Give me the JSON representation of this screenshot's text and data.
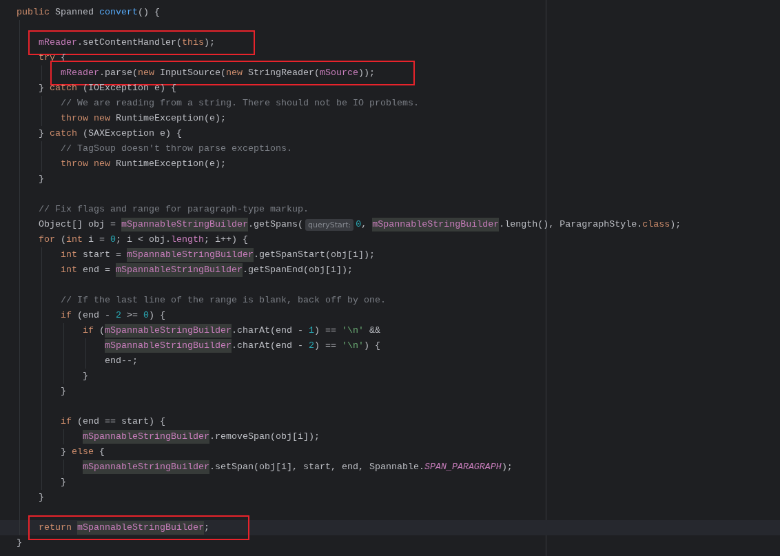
{
  "editor": {
    "lines": [
      {
        "boxed": false,
        "current": false,
        "tokens": [
          {
            "kind": "kw",
            "text": "public "
          },
          {
            "kind": "plain",
            "text": "Spanned "
          },
          {
            "kind": "decl",
            "text": "convert"
          },
          {
            "kind": "plain",
            "text": "() {"
          }
        ]
      },
      {
        "boxed": false,
        "current": false
      },
      {
        "boxed": true,
        "current": false,
        "tokens": [
          {
            "kind": "field",
            "text": "    mReader"
          },
          {
            "kind": "plain",
            "text": ".setContentHandler("
          },
          {
            "kind": "kw",
            "text": "this"
          },
          {
            "kind": "plain",
            "text": ");"
          }
        ]
      },
      {
        "boxed": false,
        "current": false,
        "tokens": [
          {
            "kind": "kw",
            "text": "    try "
          },
          {
            "kind": "plain",
            "text": "{"
          }
        ]
      },
      {
        "boxed": true,
        "current": false,
        "tokens": [
          {
            "kind": "field",
            "text": "        mReader"
          },
          {
            "kind": "plain",
            "text": ".parse("
          },
          {
            "kind": "kw",
            "text": "new "
          },
          {
            "kind": "plain",
            "text": "InputSource("
          },
          {
            "kind": "kw",
            "text": "new "
          },
          {
            "kind": "plain",
            "text": "StringReader("
          },
          {
            "kind": "field",
            "text": "mSource"
          },
          {
            "kind": "plain",
            "text": "));"
          }
        ]
      },
      {
        "boxed": false,
        "current": false,
        "tokens": [
          {
            "kind": "plain",
            "text": "    } "
          },
          {
            "kind": "kw",
            "text": "catch "
          },
          {
            "kind": "plain",
            "text": "(IOException e) {"
          }
        ]
      },
      {
        "boxed": false,
        "current": false,
        "tokens": [
          {
            "kind": "comment",
            "text": "        // We are reading from a string. There should not be IO problems."
          }
        ]
      },
      {
        "boxed": false,
        "current": false,
        "tokens": [
          {
            "kind": "kw",
            "text": "        throw new "
          },
          {
            "kind": "plain",
            "text": "RuntimeException(e);"
          }
        ]
      },
      {
        "boxed": false,
        "current": false,
        "tokens": [
          {
            "kind": "plain",
            "text": "    } "
          },
          {
            "kind": "kw",
            "text": "catch "
          },
          {
            "kind": "plain",
            "text": "(SAXException e) {"
          }
        ]
      },
      {
        "boxed": false,
        "current": false,
        "tokens": [
          {
            "kind": "comment",
            "text": "        // TagSoup doesn't throw parse exceptions."
          }
        ]
      },
      {
        "boxed": false,
        "current": false,
        "tokens": [
          {
            "kind": "kw",
            "text": "        throw new "
          },
          {
            "kind": "plain",
            "text": "RuntimeException(e);"
          }
        ]
      },
      {
        "boxed": false,
        "current": false,
        "tokens": [
          {
            "kind": "plain",
            "text": "    }"
          }
        ]
      },
      {
        "boxed": false,
        "current": false
      },
      {
        "boxed": false,
        "current": false,
        "tokens": [
          {
            "kind": "comment",
            "text": "    // Fix flags and range for paragraph-type markup."
          }
        ]
      },
      {
        "boxed": false,
        "current": false,
        "tokens": [
          {
            "kind": "plain",
            "text": "    Object[] obj = "
          },
          {
            "kind": "field-hl",
            "text": "mSpannableStringBuilder"
          },
          {
            "kind": "plain",
            "text": ".getSpans("
          },
          {
            "kind": "hint",
            "text": "queryStart:"
          },
          {
            "kind": "num",
            "text": "0"
          },
          {
            "kind": "plain",
            "text": ", "
          },
          {
            "kind": "field-hl",
            "text": "mSpannableStringBuilder"
          },
          {
            "kind": "plain",
            "text": ".length(), ParagraphStyle."
          },
          {
            "kind": "kw",
            "text": "class"
          },
          {
            "kind": "plain",
            "text": ");"
          }
        ]
      },
      {
        "boxed": false,
        "current": false,
        "tokens": [
          {
            "kind": "kw",
            "text": "    for "
          },
          {
            "kind": "plain",
            "text": "("
          },
          {
            "kind": "kw",
            "text": "int "
          },
          {
            "kind": "plain",
            "text": "i = "
          },
          {
            "kind": "num",
            "text": "0"
          },
          {
            "kind": "plain",
            "text": "; i < obj."
          },
          {
            "kind": "field",
            "text": "length"
          },
          {
            "kind": "plain",
            "text": "; i++) {"
          }
        ]
      },
      {
        "boxed": false,
        "current": false,
        "tokens": [
          {
            "kind": "kw",
            "text": "        int "
          },
          {
            "kind": "plain",
            "text": "start = "
          },
          {
            "kind": "field-hl",
            "text": "mSpannableStringBuilder"
          },
          {
            "kind": "plain",
            "text": ".getSpanStart(obj[i]);"
          }
        ]
      },
      {
        "boxed": false,
        "current": false,
        "tokens": [
          {
            "kind": "kw",
            "text": "        int "
          },
          {
            "kind": "plain",
            "text": "end = "
          },
          {
            "kind": "field-hl",
            "text": "mSpannableStringBuilder"
          },
          {
            "kind": "plain",
            "text": ".getSpanEnd(obj[i]);"
          }
        ]
      },
      {
        "boxed": false,
        "current": false
      },
      {
        "boxed": false,
        "current": false,
        "tokens": [
          {
            "kind": "comment",
            "text": "        // If the last line of the range is blank, back off by one."
          }
        ]
      },
      {
        "boxed": false,
        "current": false,
        "tokens": [
          {
            "kind": "kw",
            "text": "        if "
          },
          {
            "kind": "plain",
            "text": "(end - "
          },
          {
            "kind": "num",
            "text": "2"
          },
          {
            "kind": "plain",
            "text": " >= "
          },
          {
            "kind": "num",
            "text": "0"
          },
          {
            "kind": "plain",
            "text": ") {"
          }
        ]
      },
      {
        "boxed": false,
        "current": false,
        "tokens": [
          {
            "kind": "kw",
            "text": "            if "
          },
          {
            "kind": "plain",
            "text": "("
          },
          {
            "kind": "field-hl",
            "text": "mSpannableStringBuilder"
          },
          {
            "kind": "plain",
            "text": ".charAt(end - "
          },
          {
            "kind": "num",
            "text": "1"
          },
          {
            "kind": "plain",
            "text": ") == "
          },
          {
            "kind": "str",
            "text": "'\\n'"
          },
          {
            "kind": "plain",
            "text": " &&"
          }
        ]
      },
      {
        "boxed": false,
        "current": false,
        "tokens": [
          {
            "kind": "field-hl",
            "text": "                mSpannableStringBuilder"
          },
          {
            "kind": "plain",
            "text": ".charAt(end - "
          },
          {
            "kind": "num",
            "text": "2"
          },
          {
            "kind": "plain",
            "text": ") == "
          },
          {
            "kind": "str",
            "text": "'\\n'"
          },
          {
            "kind": "plain",
            "text": ") {"
          }
        ]
      },
      {
        "boxed": false,
        "current": false,
        "tokens": [
          {
            "kind": "plain",
            "text": "                end--;"
          }
        ]
      },
      {
        "boxed": false,
        "current": false,
        "tokens": [
          {
            "kind": "plain",
            "text": "            }"
          }
        ]
      },
      {
        "boxed": false,
        "current": false,
        "tokens": [
          {
            "kind": "plain",
            "text": "        }"
          }
        ]
      },
      {
        "boxed": false,
        "current": false
      },
      {
        "boxed": false,
        "current": false,
        "tokens": [
          {
            "kind": "kw",
            "text": "        if "
          },
          {
            "kind": "plain",
            "text": "(end == start) {"
          }
        ]
      },
      {
        "boxed": false,
        "current": false,
        "tokens": [
          {
            "kind": "field-hl",
            "text": "            mSpannableStringBuilder"
          },
          {
            "kind": "plain",
            "text": ".removeSpan(obj[i]);"
          }
        ]
      },
      {
        "boxed": false,
        "current": false,
        "tokens": [
          {
            "kind": "plain",
            "text": "        } "
          },
          {
            "kind": "kw",
            "text": "else "
          },
          {
            "kind": "plain",
            "text": "{"
          }
        ]
      },
      {
        "boxed": false,
        "current": false,
        "tokens": [
          {
            "kind": "field-hl",
            "text": "            mSpannableStringBuilder"
          },
          {
            "kind": "plain",
            "text": ".setSpan(obj[i], start, end, Spannable."
          },
          {
            "kind": "static",
            "text": "SPAN_PARAGRAPH"
          },
          {
            "kind": "plain",
            "text": ");"
          }
        ]
      },
      {
        "boxed": false,
        "current": false,
        "tokens": [
          {
            "kind": "plain",
            "text": "        }"
          }
        ]
      },
      {
        "boxed": false,
        "current": false,
        "tokens": [
          {
            "kind": "plain",
            "text": "    }"
          }
        ]
      },
      {
        "boxed": false,
        "current": false
      },
      {
        "boxed": true,
        "current": true,
        "tokens": [
          {
            "kind": "kw",
            "text": "    return "
          },
          {
            "kind": "field-hl",
            "text": "mSpannableStringBuilder"
          },
          {
            "kind": "plain",
            "text": ";"
          }
        ]
      },
      {
        "boxed": false,
        "current": false,
        "tokens": [
          {
            "kind": "plain",
            "text": "}"
          }
        ]
      }
    ]
  }
}
